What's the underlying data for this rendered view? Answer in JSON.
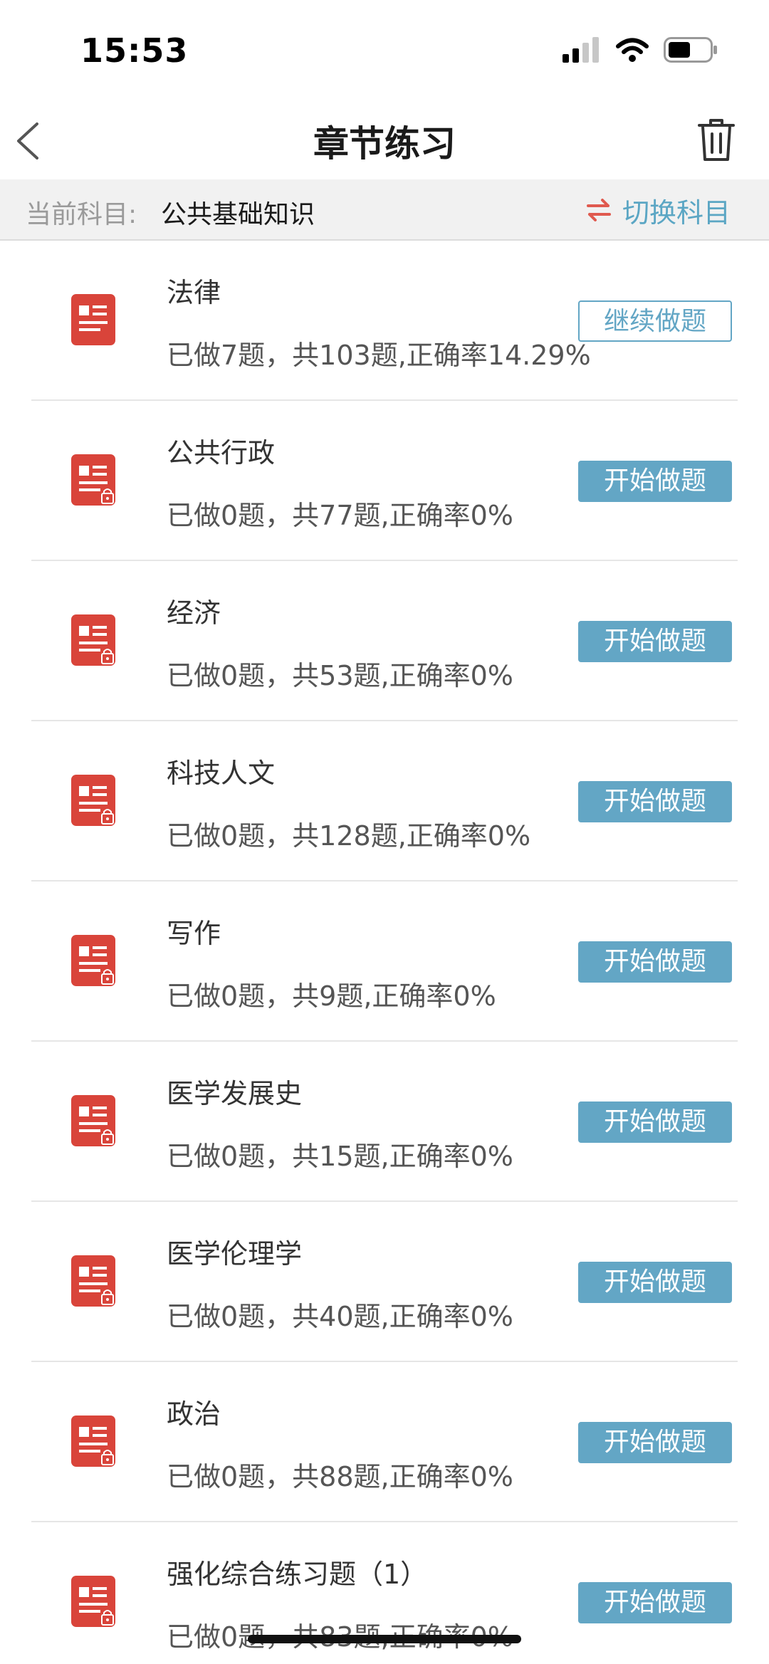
{
  "status_bar": {
    "time": "15:53",
    "icons": [
      "signal-icon",
      "wifi-icon",
      "battery-icon"
    ]
  },
  "nav": {
    "title": "章节练习",
    "back_icon": "chevron-left-icon",
    "delete_icon": "trash-icon"
  },
  "subject": {
    "label": "当前科目:",
    "name": "公共基础知识",
    "switch_label": "切换科目",
    "switch_icon": "swap-arrows-icon"
  },
  "colors": {
    "accent": "#63a6c5",
    "icon_red": "#d9443a",
    "switch_arrow_red": "#e05a4f"
  },
  "chapters": [
    {
      "title": "法律",
      "stats": "已做7题，共103题,正确率14.29%",
      "button": "继续做题",
      "locked": false
    },
    {
      "title": "公共行政",
      "stats": "已做0题，共77题,正确率0%",
      "button": "开始做题",
      "locked": true
    },
    {
      "title": "经济",
      "stats": "已做0题，共53题,正确率0%",
      "button": "开始做题",
      "locked": true
    },
    {
      "title": "科技人文",
      "stats": "已做0题，共128题,正确率0%",
      "button": "开始做题",
      "locked": true
    },
    {
      "title": "写作",
      "stats": "已做0题，共9题,正确率0%",
      "button": "开始做题",
      "locked": true
    },
    {
      "title": "医学发展史",
      "stats": "已做0题，共15题,正确率0%",
      "button": "开始做题",
      "locked": true
    },
    {
      "title": "医学伦理学",
      "stats": "已做0题，共40题,正确率0%",
      "button": "开始做题",
      "locked": true
    },
    {
      "title": "政治",
      "stats": "已做0题，共88题,正确率0%",
      "button": "开始做题",
      "locked": true
    },
    {
      "title": "强化综合练习题（1）",
      "stats": "已做0题，共83题,正确率0%",
      "button": "开始做题",
      "locked": true
    }
  ]
}
